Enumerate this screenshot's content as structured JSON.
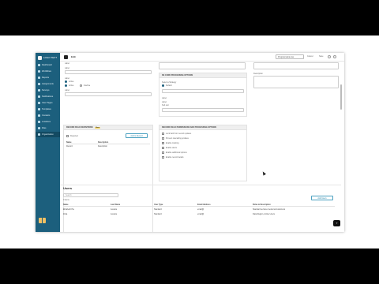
{
  "app": {
    "brand": "LOGO TEXT",
    "page_title": "Edit"
  },
  "topbar": {
    "select_value": "Programmable Ass",
    "actions": [
      "Cancel",
      "Save"
    ]
  },
  "sidebar": {
    "items": [
      {
        "label": "Dashboard"
      },
      {
        "label": "Workflows"
      },
      {
        "label": "Reports"
      },
      {
        "label": "Assignments"
      },
      {
        "label": "Surveys"
      },
      {
        "label": "Notifications"
      },
      {
        "label": "User Pages"
      },
      {
        "label": "Templates"
      },
      {
        "label": "Contacts"
      },
      {
        "label": "Locations"
      },
      {
        "label": "Files"
      },
      {
        "label": "Organization"
      }
    ]
  },
  "form": {
    "top_label": "Label",
    "input1_label": "Label",
    "group_label": "Label",
    "radio_group_title": "Label",
    "radio_options": [
      "Active",
      "Active",
      "Inactive"
    ],
    "input2_label": "Label",
    "mid_label": "Label",
    "right_label": "Description",
    "recording_panel_title": "RE CORD PROCESSING OPTIONS",
    "rec_field1_label": "Select a Strategy",
    "rec_option": "Default",
    "rec_field2_label": "Label",
    "rec_field3_label": "Label",
    "rec_field3_sub": "Sub text"
  },
  "field_panel": {
    "title": "RECORD FIELD DEFINITIONS",
    "badge": "New",
    "checkbox_label": "Required",
    "add_button": "Add to Record",
    "columns": [
      "Name",
      "Description"
    ],
    "rows": [
      {
        "name": "Record",
        "description": "Description"
      }
    ]
  },
  "options_panel": {
    "title": "RECORD FIELD PERMISSIONS AND PROCESSING OPTIONS",
    "items": [
      "Lock field from record updates",
      "Prevent cascading updates",
      "Enable tracking",
      "Enable alerts",
      "Enable additional options",
      "Enable record details"
    ]
  },
  "section2": {
    "title": "Users",
    "search_placeholder": "Search",
    "filter_label": "0 items",
    "add_button": "Add Users",
    "columns": [
      "Name",
      "Last Name",
      "User Type",
      "Email Address",
      "Roles & Description"
    ],
    "rows": [
      {
        "name": "Elizabeth Pie",
        "last": "Jessica",
        "type": "Standard",
        "email": "email@",
        "roles": "Standard service & external customers"
      },
      {
        "name": "Zulia",
        "last": "Jessica",
        "type": "Standard",
        "email": "email@",
        "roles": "Data Region, Active Users"
      }
    ]
  }
}
